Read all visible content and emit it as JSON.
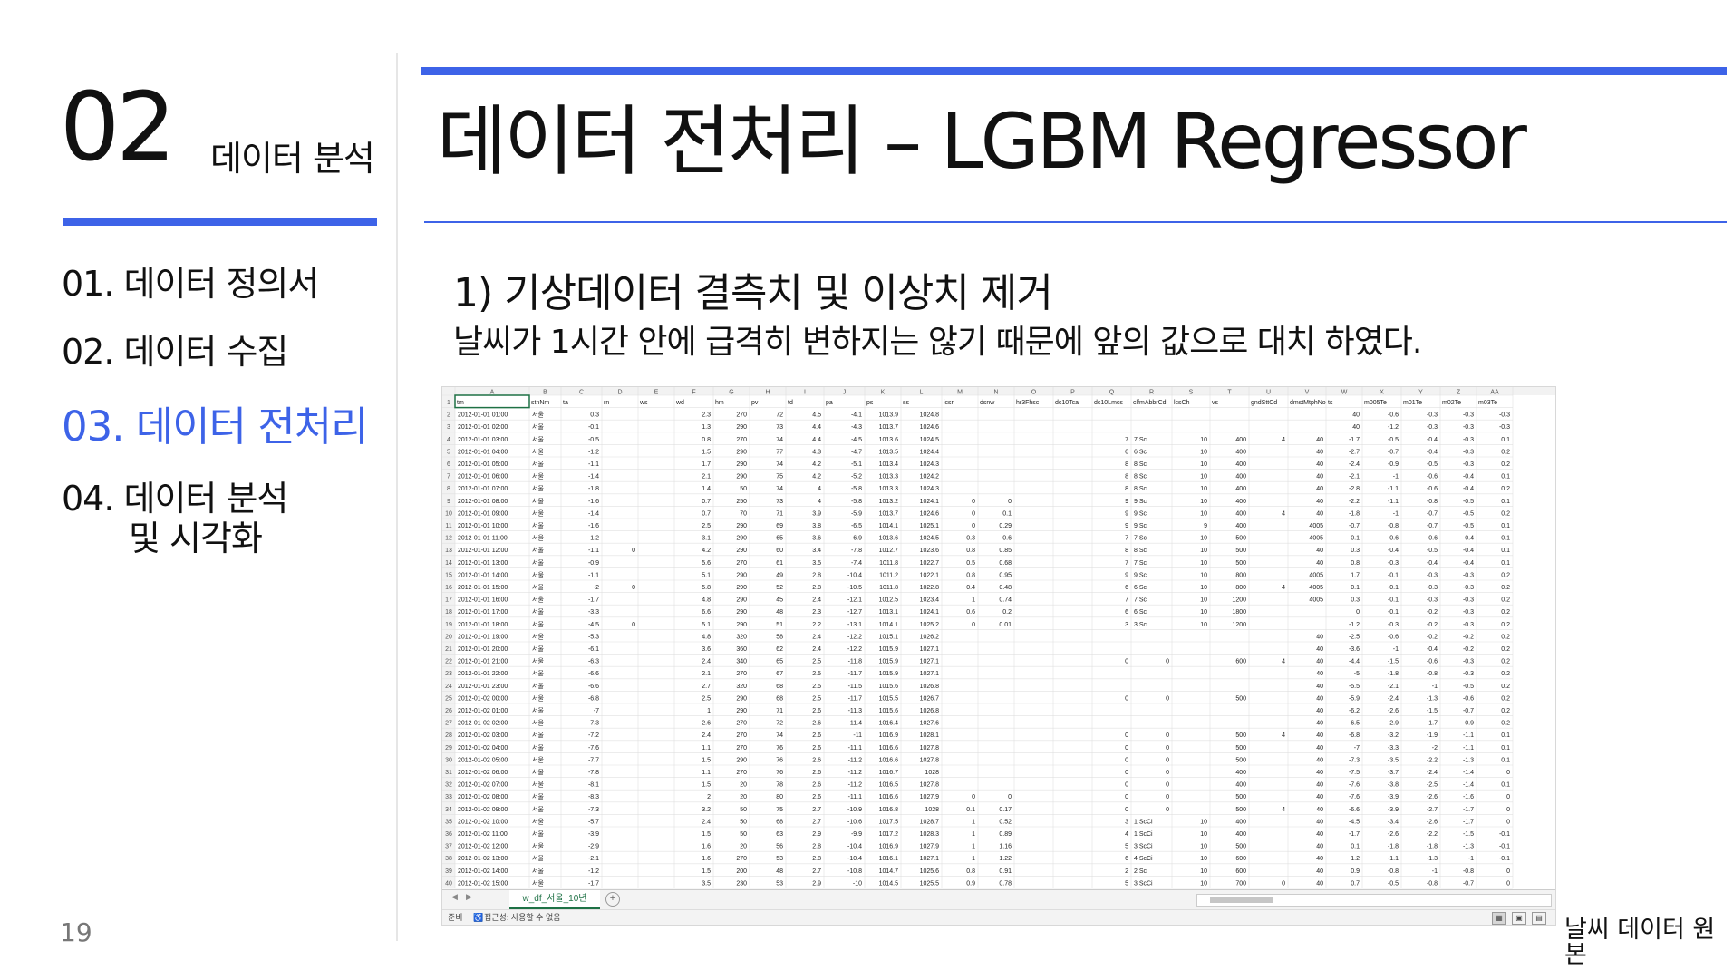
{
  "left": {
    "section_number": "02",
    "section_label": "데이터 분석",
    "nav": [
      {
        "label": "01. 데이터 정의서"
      },
      {
        "label": "02. 데이터 수집"
      },
      {
        "label": "03. 데이터 전처리"
      },
      {
        "label": "04. 데이터 분석"
      },
      {
        "label": "및 시각화"
      }
    ],
    "page_number": "19"
  },
  "main": {
    "title": "데이터 전처리 – LGBM Regressor",
    "subheading": "1) 기상데이터 결측치 및 이상치 제거",
    "description": "날씨가 1시간 안에 급격히 변하지는 않기 때문에 앞의 값으로 대치 하였다.",
    "caption": "날씨 데이터 원본"
  },
  "sheet": {
    "column_letters": [
      "A",
      "B",
      "C",
      "D",
      "E",
      "F",
      "G",
      "H",
      "I",
      "J",
      "K",
      "L",
      "M",
      "N",
      "O",
      "P",
      "Q",
      "R",
      "S",
      "T",
      "U",
      "V",
      "W",
      "X",
      "Y",
      "Z",
      "AA"
    ],
    "headers": [
      "tm",
      "stnNm",
      "ta",
      "rn",
      "ws",
      "wd",
      "hm",
      "pv",
      "td",
      "pa",
      "ps",
      "ss",
      "icsr",
      "dsnw",
      "hr3Fhsc",
      "dc10Tca",
      "dc10Lmcs",
      "clfmAbbrCd",
      "lcsCh",
      "vs",
      "gndSttCd",
      "dmstMtphNo",
      "ts",
      "m005Te",
      "m01Te",
      "m02Te",
      "m03Te"
    ],
    "row_labels": [
      "1",
      "2",
      "3",
      "4",
      "5",
      "6",
      "7",
      "8",
      "9",
      "10",
      "11",
      "12",
      "13",
      "14",
      "15",
      "16",
      "17",
      "18",
      "19",
      "20",
      "21",
      "22",
      "23",
      "24",
      "25",
      "26",
      "27",
      "28",
      "29",
      "30",
      "31",
      "32",
      "33",
      "34",
      "35",
      "36",
      "37",
      "38",
      "39",
      "40"
    ],
    "rows": [
      [
        "2012-01-01 01:00",
        "서울",
        "0.3",
        "",
        "",
        "2.3",
        "270",
        "72",
        "4.5",
        "-4.1",
        "1013.9",
        "1024.8",
        "",
        "",
        "",
        "",
        "",
        "",
        "",
        "",
        "",
        "",
        "40",
        "-0.6",
        "-0.3",
        "-0.3",
        "-0.3",
        "0.1"
      ],
      [
        "2012-01-01 02:00",
        "서울",
        "-0.1",
        "",
        "",
        "1.3",
        "290",
        "73",
        "4.4",
        "-4.3",
        "1013.7",
        "1024.6",
        "",
        "",
        "",
        "",
        "",
        "",
        "",
        "",
        "",
        "",
        "40",
        "-1.2",
        "-0.3",
        "-0.3",
        "-0.3",
        "0.2"
      ],
      [
        "2012-01-01 03:00",
        "서울",
        "-0.5",
        "",
        "",
        "0.8",
        "270",
        "74",
        "4.4",
        "-4.5",
        "1013.6",
        "1024.5",
        "",
        "",
        "",
        "",
        "7",
        "7 Sc",
        "10",
        "400",
        "4",
        "40",
        "-1.7",
        "-0.5",
        "-0.4",
        "-0.3",
        "0.1"
      ],
      [
        "2012-01-01 04:00",
        "서울",
        "-1.2",
        "",
        "",
        "1.5",
        "290",
        "77",
        "4.3",
        "-4.7",
        "1013.5",
        "1024.4",
        "",
        "",
        "",
        "",
        "6",
        "6 Sc",
        "10",
        "400",
        "",
        "40",
        "-2.7",
        "-0.7",
        "-0.4",
        "-0.3",
        "0.2"
      ],
      [
        "2012-01-01 05:00",
        "서울",
        "-1.1",
        "",
        "",
        "1.7",
        "290",
        "74",
        "4.2",
        "-5.1",
        "1013.4",
        "1024.3",
        "",
        "",
        "",
        "",
        "8",
        "8 Sc",
        "10",
        "400",
        "",
        "40",
        "-2.4",
        "-0.9",
        "-0.5",
        "-0.3",
        "0.2"
      ],
      [
        "2012-01-01 06:00",
        "서울",
        "-1.4",
        "",
        "",
        "2.1",
        "290",
        "75",
        "4.2",
        "-5.2",
        "1013.3",
        "1024.2",
        "",
        "",
        "",
        "",
        "8",
        "8 Sc",
        "10",
        "400",
        "",
        "40",
        "-2.1",
        "-1",
        "-0.6",
        "-0.4",
        "0.1"
      ],
      [
        "2012-01-01 07:00",
        "서울",
        "-1.8",
        "",
        "",
        "1.4",
        "50",
        "74",
        "4",
        "-5.8",
        "1013.3",
        "1024.3",
        "",
        "",
        "",
        "",
        "8",
        "8 Sc",
        "10",
        "400",
        "",
        "40",
        "-2.8",
        "-1.1",
        "-0.6",
        "-0.4",
        "0.2"
      ],
      [
        "2012-01-01 08:00",
        "서울",
        "-1.6",
        "",
        "",
        "0.7",
        "250",
        "73",
        "4",
        "-5.8",
        "1013.2",
        "1024.1",
        "0",
        "0",
        "",
        "",
        "9",
        "9 Sc",
        "10",
        "400",
        "",
        "40",
        "-2.2",
        "-1.1",
        "-0.8",
        "-0.5",
        "0.1"
      ],
      [
        "2012-01-01 09:00",
        "서울",
        "-1.4",
        "",
        "",
        "0.7",
        "70",
        "71",
        "3.9",
        "-5.9",
        "1013.7",
        "1024.6",
        "0",
        "0.1",
        "",
        "",
        "9",
        "9 Sc",
        "10",
        "400",
        "4",
        "40",
        "-1.8",
        "-1",
        "-0.7",
        "-0.5",
        "0.2"
      ],
      [
        "2012-01-01 10:00",
        "서울",
        "-1.6",
        "",
        "",
        "2.5",
        "290",
        "69",
        "3.8",
        "-6.5",
        "1014.1",
        "1025.1",
        "0",
        "0.29",
        "",
        "",
        "9",
        "9 Sc",
        "9",
        "400",
        "",
        "4005",
        "-0.7",
        "-0.8",
        "-0.7",
        "-0.5",
        "0.1"
      ],
      [
        "2012-01-01 11:00",
        "서울",
        "-1.2",
        "",
        "",
        "3.1",
        "290",
        "65",
        "3.6",
        "-6.9",
        "1013.6",
        "1024.5",
        "0.3",
        "0.6",
        "",
        "",
        "7",
        "7 Sc",
        "10",
        "500",
        "",
        "4005",
        "-0.1",
        "-0.6",
        "-0.6",
        "-0.4",
        "0.1"
      ],
      [
        "2012-01-01 12:00",
        "서울",
        "-1.1",
        "0",
        "",
        "4.2",
        "290",
        "60",
        "3.4",
        "-7.8",
        "1012.7",
        "1023.6",
        "0.8",
        "0.85",
        "",
        "",
        "8",
        "8 Sc",
        "10",
        "500",
        "",
        "40",
        "0.3",
        "-0.4",
        "-0.5",
        "-0.4",
        "0.1"
      ],
      [
        "2012-01-01 13:00",
        "서울",
        "-0.9",
        "",
        "",
        "5.6",
        "270",
        "61",
        "3.5",
        "-7.4",
        "1011.8",
        "1022.7",
        "0.5",
        "0.68",
        "",
        "",
        "7",
        "7 Sc",
        "10",
        "500",
        "",
        "40",
        "0.8",
        "-0.3",
        "-0.4",
        "-0.4",
        "0.1"
      ],
      [
        "2012-01-01 14:00",
        "서울",
        "-1.1",
        "",
        "",
        "5.1",
        "290",
        "49",
        "2.8",
        "-10.4",
        "1011.2",
        "1022.1",
        "0.8",
        "0.95",
        "",
        "",
        "9",
        "9 Sc",
        "10",
        "800",
        "",
        "4005",
        "1.7",
        "-0.1",
        "-0.3",
        "-0.3",
        "0.2"
      ],
      [
        "2012-01-01 15:00",
        "서울",
        "-2",
        "0",
        "",
        "5.8",
        "290",
        "52",
        "2.8",
        "-10.5",
        "1011.8",
        "1022.8",
        "0.4",
        "0.48",
        "",
        "",
        "6",
        "6 Sc",
        "10",
        "800",
        "4",
        "4005",
        "0.1",
        "-0.1",
        "-0.3",
        "-0.3",
        "0.2"
      ],
      [
        "2012-01-01 16:00",
        "서울",
        "-1.7",
        "",
        "",
        "4.8",
        "290",
        "45",
        "2.4",
        "-12.1",
        "1012.5",
        "1023.4",
        "1",
        "0.74",
        "",
        "",
        "7",
        "7 Sc",
        "10",
        "1200",
        "",
        "4005",
        "0.3",
        "-0.1",
        "-0.3",
        "-0.3",
        "0.2"
      ],
      [
        "2012-01-01 17:00",
        "서울",
        "-3.3",
        "",
        "",
        "6.6",
        "290",
        "48",
        "2.3",
        "-12.7",
        "1013.1",
        "1024.1",
        "0.6",
        "0.2",
        "",
        "",
        "6",
        "6 Sc",
        "10",
        "1800",
        "",
        "",
        "0",
        "-0.1",
        "-0.2",
        "-0.3",
        "0.2"
      ],
      [
        "2012-01-01 18:00",
        "서울",
        "-4.5",
        "0",
        "",
        "5.1",
        "290",
        "51",
        "2.2",
        "-13.1",
        "1014.1",
        "1025.2",
        "0",
        "0.01",
        "",
        "",
        "3",
        "3 Sc",
        "10",
        "1200",
        "",
        "",
        "-1.2",
        "-0.3",
        "-0.2",
        "-0.3",
        "0.2"
      ],
      [
        "2012-01-01 19:00",
        "서울",
        "-5.3",
        "",
        "",
        "4.8",
        "320",
        "58",
        "2.4",
        "-12.2",
        "1015.1",
        "1026.2",
        "",
        "",
        "",
        "",
        "",
        "",
        "",
        "",
        "",
        "40",
        "-2.5",
        "-0.6",
        "-0.2",
        "-0.2",
        "0.2"
      ],
      [
        "2012-01-01 20:00",
        "서울",
        "-6.1",
        "",
        "",
        "3.6",
        "360",
        "62",
        "2.4",
        "-12.2",
        "1015.9",
        "1027.1",
        "",
        "",
        "",
        "",
        "",
        "",
        "",
        "",
        "",
        "40",
        "-3.6",
        "-1",
        "-0.4",
        "-0.2",
        "0.2"
      ],
      [
        "2012-01-01 21:00",
        "서울",
        "-6.3",
        "",
        "",
        "2.4",
        "340",
        "65",
        "2.5",
        "-11.8",
        "1015.9",
        "1027.1",
        "",
        "",
        "",
        "",
        "0",
        "0",
        "",
        "600",
        "4",
        "40",
        "-4.4",
        "-1.5",
        "-0.6",
        "-0.3",
        "0.2"
      ],
      [
        "2012-01-01 22:00",
        "서울",
        "-6.6",
        "",
        "",
        "2.1",
        "270",
        "67",
        "2.5",
        "-11.7",
        "1015.9",
        "1027.1",
        "",
        "",
        "",
        "",
        "",
        "",
        "",
        "",
        "",
        "40",
        "-5",
        "-1.8",
        "-0.8",
        "-0.3",
        "0.2"
      ],
      [
        "2012-01-01 23:00",
        "서울",
        "-6.6",
        "",
        "",
        "2.7",
        "320",
        "68",
        "2.5",
        "-11.5",
        "1015.6",
        "1026.8",
        "",
        "",
        "",
        "",
        "",
        "",
        "",
        "",
        "",
        "40",
        "-5.5",
        "-2.1",
        "-1",
        "-0.5",
        "0.2"
      ],
      [
        "2012-01-02 00:00",
        "서울",
        "-6.8",
        "",
        "",
        "2.5",
        "290",
        "68",
        "2.5",
        "-11.7",
        "1015.5",
        "1026.7",
        "",
        "",
        "",
        "",
        "0",
        "0",
        "",
        "500",
        "",
        "40",
        "-5.9",
        "-2.4",
        "-1.3",
        "-0.6",
        "0.2"
      ],
      [
        "2012-01-02 01:00",
        "서울",
        "-7",
        "",
        "",
        "1",
        "290",
        "71",
        "2.6",
        "-11.3",
        "1015.6",
        "1026.8",
        "",
        "",
        "",
        "",
        "",
        "",
        "",
        "",
        "",
        "40",
        "-6.2",
        "-2.6",
        "-1.5",
        "-0.7",
        "0.2"
      ],
      [
        "2012-01-02 02:00",
        "서울",
        "-7.3",
        "",
        "",
        "2.6",
        "270",
        "72",
        "2.6",
        "-11.4",
        "1016.4",
        "1027.6",
        "",
        "",
        "",
        "",
        "",
        "",
        "",
        "",
        "",
        "40",
        "-6.5",
        "-2.9",
        "-1.7",
        "-0.9",
        "0.2"
      ],
      [
        "2012-01-02 03:00",
        "서울",
        "-7.2",
        "",
        "",
        "2.4",
        "270",
        "74",
        "2.6",
        "-11",
        "1016.9",
        "1028.1",
        "",
        "",
        "",
        "",
        "0",
        "0",
        "",
        "500",
        "4",
        "40",
        "-6.8",
        "-3.2",
        "-1.9",
        "-1.1",
        "0.1"
      ],
      [
        "2012-01-02 04:00",
        "서울",
        "-7.6",
        "",
        "",
        "1.1",
        "270",
        "76",
        "2.6",
        "-11.1",
        "1016.6",
        "1027.8",
        "",
        "",
        "",
        "",
        "0",
        "0",
        "",
        "500",
        "",
        "40",
        "-7",
        "-3.3",
        "-2",
        "-1.1",
        "0.1"
      ],
      [
        "2012-01-02 05:00",
        "서울",
        "-7.7",
        "",
        "",
        "1.5",
        "290",
        "76",
        "2.6",
        "-11.2",
        "1016.6",
        "1027.8",
        "",
        "",
        "",
        "",
        "0",
        "0",
        "",
        "500",
        "",
        "40",
        "-7.3",
        "-3.5",
        "-2.2",
        "-1.3",
        "0.1"
      ],
      [
        "2012-01-02 06:00",
        "서울",
        "-7.8",
        "",
        "",
        "1.1",
        "270",
        "76",
        "2.6",
        "-11.2",
        "1016.7",
        "1028",
        "",
        "",
        "",
        "",
        "0",
        "0",
        "",
        "400",
        "",
        "40",
        "-7.5",
        "-3.7",
        "-2.4",
        "-1.4",
        "0"
      ],
      [
        "2012-01-02 07:00",
        "서울",
        "-8.1",
        "",
        "",
        "1.5",
        "20",
        "78",
        "2.6",
        "-11.2",
        "1016.5",
        "1027.8",
        "",
        "",
        "",
        "",
        "0",
        "0",
        "",
        "400",
        "",
        "40",
        "-7.6",
        "-3.8",
        "-2.5",
        "-1.4",
        "0.1"
      ],
      [
        "2012-01-02 08:00",
        "서울",
        "-8.3",
        "",
        "",
        "2",
        "20",
        "80",
        "2.6",
        "-11.1",
        "1016.6",
        "1027.9",
        "0",
        "0",
        "",
        "",
        "0",
        "0",
        "",
        "500",
        "",
        "40",
        "-7.6",
        "-3.9",
        "-2.6",
        "-1.6",
        "0"
      ],
      [
        "2012-01-02 09:00",
        "서울",
        "-7.3",
        "",
        "",
        "3.2",
        "50",
        "75",
        "2.7",
        "-10.9",
        "1016.8",
        "1028",
        "0.1",
        "0.17",
        "",
        "",
        "0",
        "0",
        "",
        "500",
        "4",
        "40",
        "-6.6",
        "-3.9",
        "-2.7",
        "-1.7",
        "0"
      ],
      [
        "2012-01-02 10:00",
        "서울",
        "-5.7",
        "",
        "",
        "2.4",
        "50",
        "68",
        "2.7",
        "-10.6",
        "1017.5",
        "1028.7",
        "1",
        "0.52",
        "",
        "",
        "3",
        "1 ScCi",
        "10",
        "400",
        "",
        "40",
        "-4.5",
        "-3.4",
        "-2.6",
        "-1.7",
        "0"
      ],
      [
        "2012-01-02 11:00",
        "서울",
        "-3.9",
        "",
        "",
        "1.5",
        "50",
        "63",
        "2.9",
        "-9.9",
        "1017.2",
        "1028.3",
        "1",
        "0.89",
        "",
        "",
        "4",
        "1 ScCi",
        "10",
        "400",
        "",
        "40",
        "-1.7",
        "-2.6",
        "-2.2",
        "-1.5",
        "-0.1"
      ],
      [
        "2012-01-02 12:00",
        "서울",
        "-2.9",
        "",
        "",
        "1.6",
        "20",
        "56",
        "2.8",
        "-10.4",
        "1016.9",
        "1027.9",
        "1",
        "1.16",
        "",
        "",
        "5",
        "3 ScCi",
        "10",
        "500",
        "",
        "40",
        "0.1",
        "-1.8",
        "-1.8",
        "-1.3",
        "-0.1"
      ],
      [
        "2012-01-02 13:00",
        "서울",
        "-2.1",
        "",
        "",
        "1.6",
        "270",
        "53",
        "2.8",
        "-10.4",
        "1016.1",
        "1027.1",
        "1",
        "1.22",
        "",
        "",
        "6",
        "4 ScCi",
        "10",
        "600",
        "",
        "40",
        "1.2",
        "-1.1",
        "-1.3",
        "-1",
        "-0.1"
      ],
      [
        "2012-01-02 14:00",
        "서울",
        "-1.2",
        "",
        "",
        "1.5",
        "200",
        "48",
        "2.7",
        "-10.8",
        "1014.7",
        "1025.6",
        "0.8",
        "0.91",
        "",
        "",
        "2",
        "2 Sc",
        "10",
        "600",
        "",
        "40",
        "0.9",
        "-0.8",
        "-1",
        "-0.8",
        "0"
      ],
      [
        "2012-01-02 15:00",
        "서울",
        "-1.7",
        "",
        "",
        "3.5",
        "230",
        "53",
        "2.9",
        "-10",
        "1014.5",
        "1025.5",
        "0.9",
        "0.78",
        "",
        "",
        "5",
        "3 ScCi",
        "10",
        "700",
        "0",
        "40",
        "0.7",
        "-0.5",
        "-0.8",
        "-0.7",
        "0"
      ]
    ],
    "sheet_tab": "w_df_서울_10년",
    "status_ready": "준비",
    "status_accessibility": "접근성: 사용할 수 없음"
  }
}
